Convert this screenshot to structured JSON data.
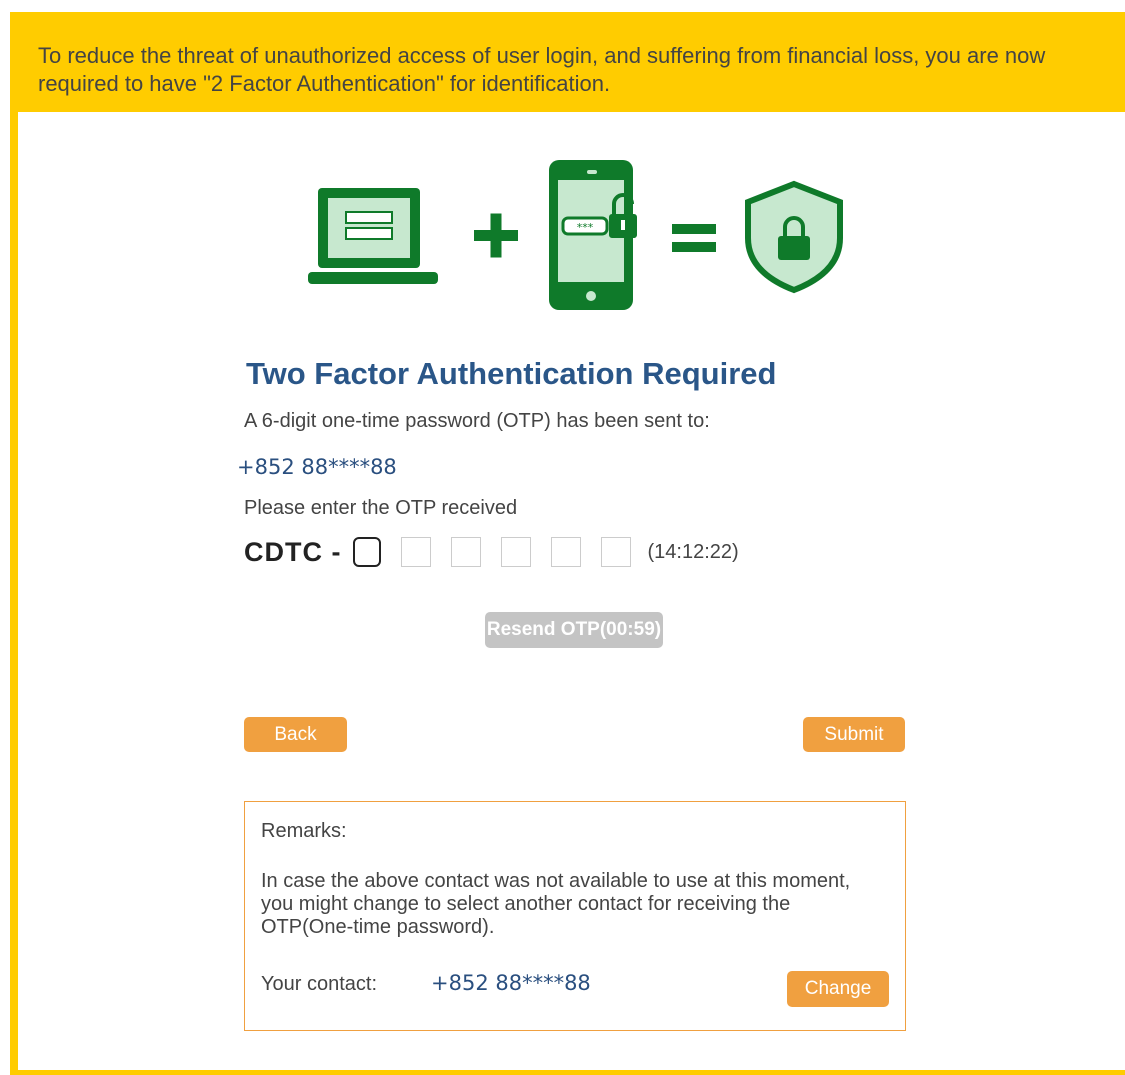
{
  "notice": {
    "text": "To reduce the threat of unauthorized access of user login, and suffering from financial loss, you are now required to have \"2 Factor Authentication\" for identification."
  },
  "colors": {
    "notice_bg": "#ffcc00",
    "icon_green": "#0f7a2a",
    "title_blue": "#2a5688",
    "button_orange": "#f0a040",
    "disabled_gray": "#c4c4c4"
  },
  "hero": {
    "icons": [
      "laptop-icon",
      "plus-icon",
      "smartphone-lock-icon",
      "equals-icon",
      "shield-lock-icon"
    ]
  },
  "auth": {
    "title": "Two Factor Authentication Required",
    "sent_to_text": "A 6-digit one-time password (OTP) has been sent to:",
    "phone": "+852 88****88",
    "enter_text": "Please enter the OTP received",
    "otp_prefix": "CDTC -",
    "otp_digits": [
      "",
      "",
      "",
      "",
      "",
      ""
    ],
    "timer": "(14:12:22)",
    "resend_label": "Resend OTP(00:59)"
  },
  "actions": {
    "back_label": "Back",
    "submit_label": "Submit"
  },
  "remarks": {
    "title": "Remarks:",
    "body": "In case the above contact was not available to use at this moment, you might change to select another contact for receiving the OTP(One-time password).",
    "contact_label": "Your contact:",
    "contact_value": "+852 88****88",
    "change_label": "Change"
  }
}
